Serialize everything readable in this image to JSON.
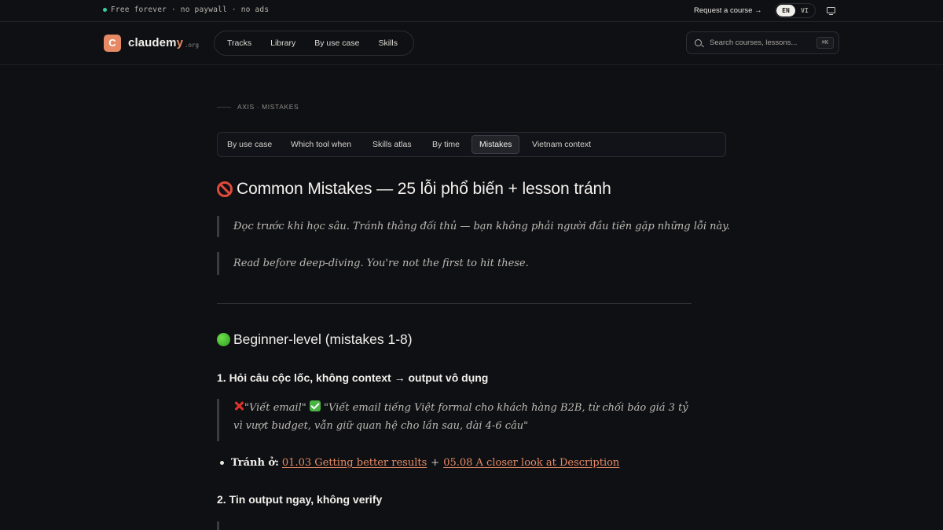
{
  "topbar": {
    "tagline": "Free forever · no paywall · no ads",
    "request_link": "Request a course →",
    "languages": [
      "EN",
      "VI"
    ],
    "active_language": "EN"
  },
  "navbar": {
    "logo_letter": "C",
    "logo_name": "claudem",
    "logo_name_accent": "y",
    "logo_suffix": ".org",
    "links": [
      "Tracks",
      "Library",
      "By use case",
      "Skills"
    ],
    "search_placeholder": "Search courses, lessons...",
    "search_shortcut": "⌘K"
  },
  "eyebrow": "AXIS · MISTAKES",
  "tabs": [
    "By use case",
    "Which tool when",
    "Skills atlas",
    "By time",
    "Mistakes",
    "Vietnam context"
  ],
  "active_tab": "Mistakes",
  "article": {
    "title": "Common Mistakes — 25 lỗi phổ biến + lesson tránh",
    "intro_vi": "Đọc trước khi học sâu. Tránh thằng đối thủ — bạn không phải người đầu tiên gặp những lỗi này.",
    "intro_en": "Read before deep-diving. You're not the first to hit these.",
    "section_title": "Beginner-level (mistakes 1-8)",
    "mistake_1_title": "1. Hỏi câu cộc lốc, không context → output vô dụng",
    "mistake_1_bad": "\"Viết email\"",
    "mistake_1_good": "\"Viết email tiếng Việt formal cho khách hàng B2B, từ chối báo giá 3 tỷ vì vượt budget, vẫn giữ quan hệ cho lần sau, dài 4-6 câu\"",
    "mistake_1_avoid_label": "Tránh ở:",
    "mistake_1_link_1": "01.03 Getting better results",
    "mistake_1_plus": "+",
    "mistake_1_link_2": "05.08 A closer look at Description",
    "mistake_2_title": "2. Tin output ngay, không verify"
  },
  "colors": {
    "background": "#0f1014",
    "accent": "#e58a64",
    "status_dot": "#37d29a"
  }
}
